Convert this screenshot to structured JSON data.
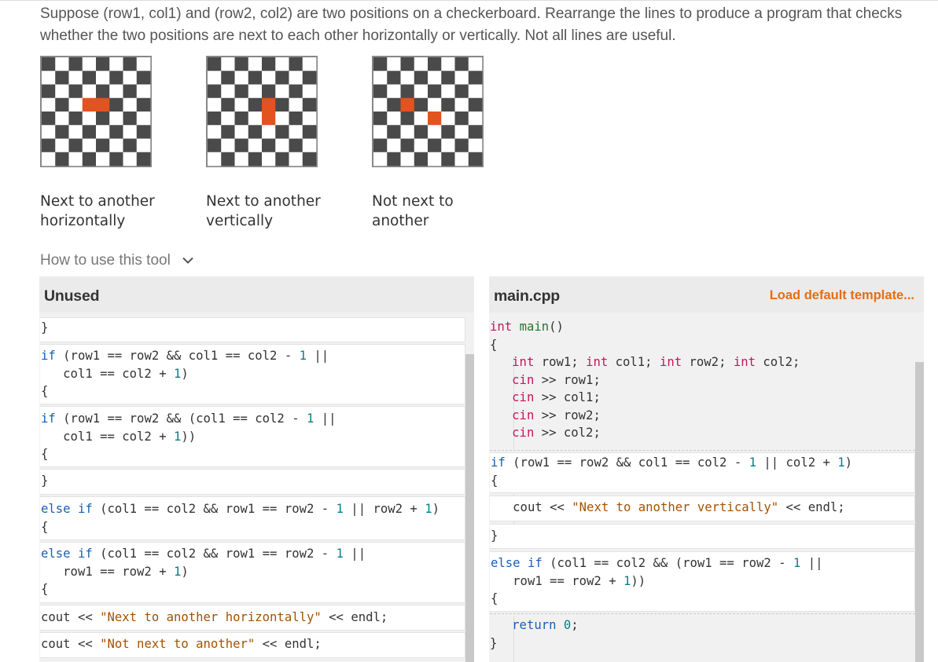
{
  "instructions": "Suppose (row1, col1) and (row2, col2) are two positions on a checkerboard. Rearrange the lines to produce a program that checks whether the two positions are next to each other horizontally or vertically. Not all lines are useful.",
  "examples": [
    {
      "caption_line1": "Next to another",
      "caption_line2": "horizontally",
      "highlighted": [
        [
          3,
          3
        ],
        [
          3,
          4
        ]
      ]
    },
    {
      "caption_line1": "Next to another",
      "caption_line2": "vertically",
      "highlighted": [
        [
          3,
          4
        ],
        [
          4,
          4
        ]
      ]
    },
    {
      "caption_line1": "Not next to",
      "caption_line2": "another",
      "highlighted": [
        [
          3,
          2
        ],
        [
          4,
          4
        ]
      ]
    }
  ],
  "colors": {
    "highlight": "#e2531f",
    "dark_square": "#4a4a4a",
    "accent": "#e86d0f"
  },
  "howto_label": "How to use this tool",
  "unused_title": "Unused",
  "editor_title": "main.cpp",
  "load_template_label": "Load default template...",
  "unused": [
    {
      "lines": [
        "}"
      ]
    },
    {
      "lines": [
        "if (row1 == row2 && col1 == col2 - 1 ||",
        "   col1 == col2 + 1)",
        "{"
      ]
    },
    {
      "lines": [
        "if (row1 == row2 && (col1 == col2 - 1 ||",
        "   col1 == col2 + 1))",
        "{"
      ]
    },
    {
      "lines": [
        "}"
      ]
    },
    {
      "lines": [
        "else if (col1 == col2 && row1 == row2 - 1 || row2 + 1)",
        "{"
      ]
    },
    {
      "lines": [
        "else if (col1 == col2 && row1 == row2 - 1 ||",
        "   row1 == row2 + 1)",
        "{"
      ]
    },
    {
      "lines": [
        "cout << \"Next to another horizontally\" << endl;"
      ]
    },
    {
      "lines": [
        "cout << \"Not next to another\" << endl;"
      ]
    }
  ],
  "editor_head": [
    "int main()",
    "{",
    "   int row1; int col1; int row2; int col2;",
    "   cin >> row1;",
    "   cin >> col1;",
    "   cin >> row2;",
    "   cin >> col2;"
  ],
  "placed": [
    {
      "lines": [
        "if (row1 == row2 && col1 == col2 - 1 || col2 + 1)",
        "{"
      ]
    },
    {
      "lines": [
        "   cout << \"Next to another vertically\" << endl;"
      ]
    },
    {
      "lines": [
        "}"
      ]
    },
    {
      "lines": [
        "else if (col1 == col2 && (row1 == row2 - 1 ||",
        "   row1 == row2 + 1))",
        "{"
      ]
    }
  ],
  "editor_tail": [
    "   return 0;",
    "}"
  ]
}
